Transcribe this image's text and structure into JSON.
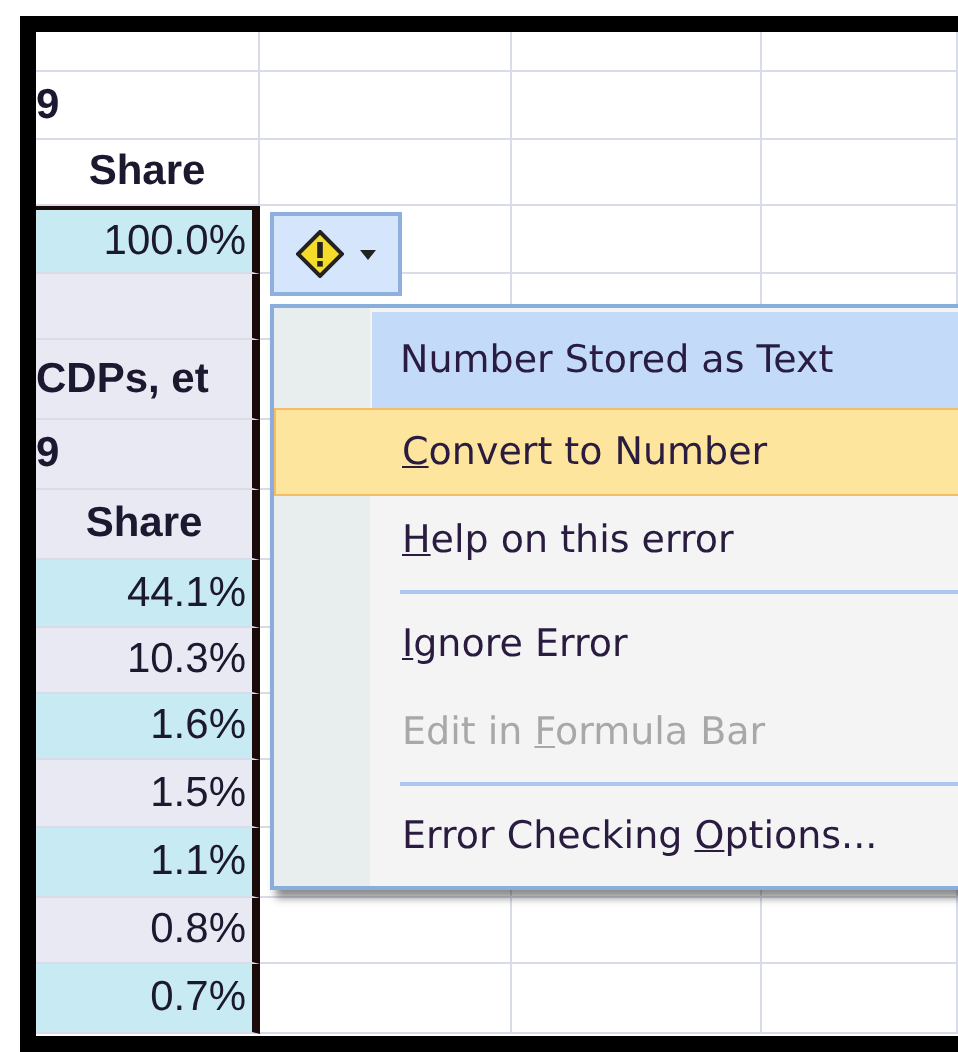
{
  "sheet": {
    "rows": [
      {
        "color": "#ffffff"
      },
      {
        "kind": "label",
        "text": "9",
        "color": "#ffffff"
      },
      {
        "kind": "header",
        "text": "Share",
        "color": "#ffffff"
      },
      {
        "kind": "value",
        "text": "100.0%",
        "color": "#c8eaf2",
        "outlined": true
      },
      {
        "color": "#e9e9f3",
        "outlined": true
      },
      {
        "kind": "label",
        "text": "CDPs, et",
        "color": "#e9e9f3",
        "outlined": true
      },
      {
        "kind": "label",
        "text": "9",
        "color": "#e9e9f3",
        "outlined": true
      },
      {
        "kind": "header",
        "text": "Share",
        "color": "#e9e9f3",
        "outlined": true
      },
      {
        "kind": "value",
        "text": "44.1%",
        "color": "#c8eaf2",
        "outlined": true
      },
      {
        "kind": "value",
        "text": "10.3%",
        "color": "#e9e9f3",
        "outlined": true
      },
      {
        "kind": "value",
        "text": "1.6%",
        "color": "#c8eaf2",
        "outlined": true
      },
      {
        "kind": "value",
        "text": "1.5%",
        "color": "#e9e9f3",
        "outlined": true
      },
      {
        "kind": "value",
        "text": "1.1%",
        "color": "#c8eaf2",
        "outlined": true
      },
      {
        "kind": "value",
        "text": "0.8%",
        "color": "#e9e9f3",
        "outlined": true
      },
      {
        "kind": "value",
        "text": "0.7%",
        "color": "#c8eaf2",
        "outlined": true
      }
    ]
  },
  "error_menu": {
    "items": [
      {
        "kind": "title",
        "label": {
          "after": "Number Stored as Text"
        }
      },
      {
        "kind": "item",
        "label": {
          "accelerator": "C",
          "after": "onvert to Number"
        },
        "selected": true,
        "disabled": false
      },
      {
        "kind": "item",
        "label": {
          "accelerator": "H",
          "after": "elp on this error"
        },
        "selected": false,
        "disabled": false
      },
      {
        "kind": "separator"
      },
      {
        "kind": "item",
        "label": {
          "accelerator": "I",
          "after": "gnore Error"
        },
        "selected": false,
        "disabled": false
      },
      {
        "kind": "item",
        "label": {
          "before": "Edit in ",
          "accelerator": "F",
          "after": "ormula Bar"
        },
        "selected": false,
        "disabled": true
      },
      {
        "kind": "separator"
      },
      {
        "kind": "item",
        "label": {
          "before": "Error Checking ",
          "accelerator": "O",
          "after": "ptions..."
        },
        "selected": false,
        "disabled": false
      }
    ]
  }
}
